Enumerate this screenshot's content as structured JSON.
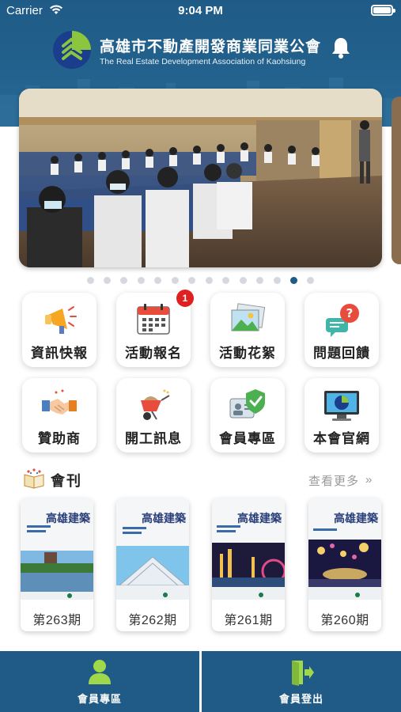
{
  "status_bar": {
    "carrier": "Carrier",
    "time": "9:04 PM"
  },
  "header": {
    "title": "高雄市不動產開發商業同業公會",
    "subtitle": "The Real Estate Development Association of Kaohsiung"
  },
  "carousel": {
    "page_count": 14,
    "active_index": 12
  },
  "menu": [
    {
      "label": "資訊快報",
      "icon": "megaphone-icon"
    },
    {
      "label": "活動報名",
      "icon": "calendar-icon",
      "badge": "1"
    },
    {
      "label": "活動花絮",
      "icon": "photo-icon"
    },
    {
      "label": "問題回饋",
      "icon": "question-chat-icon"
    },
    {
      "label": "贊助商",
      "icon": "handshake-icon"
    },
    {
      "label": "開工訊息",
      "icon": "wheelbarrow-icon"
    },
    {
      "label": "會員專區",
      "icon": "member-id-icon"
    },
    {
      "label": "本會官網",
      "icon": "monitor-icon"
    }
  ],
  "journal": {
    "title": "會刊",
    "more": "查看更多",
    "issues": [
      {
        "label": "第263期",
        "cover_title": "高雄建築"
      },
      {
        "label": "第262期",
        "cover_title": "高雄建築"
      },
      {
        "label": "第261期",
        "cover_title": "高雄建築"
      },
      {
        "label": "第260期",
        "cover_title": "高雄建築"
      }
    ]
  },
  "bottom_nav": {
    "member": "會員專區",
    "logout": "會員登出"
  },
  "colors": {
    "primary": "#1f5b86",
    "badge": "#e02020"
  }
}
